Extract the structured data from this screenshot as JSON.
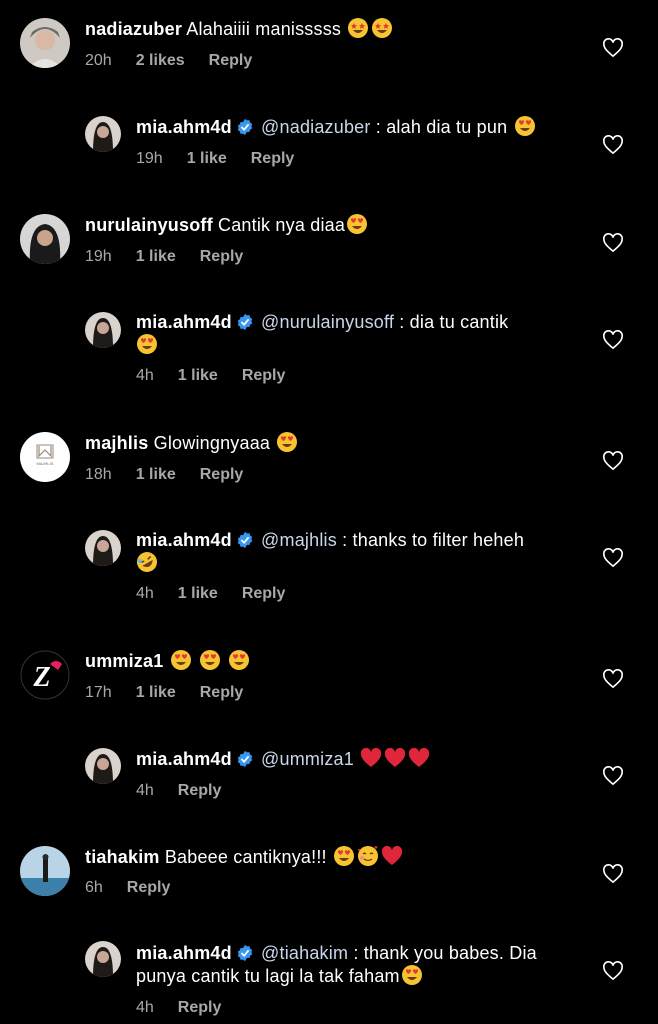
{
  "comments": [
    {
      "user": "nadiazuber",
      "text": "Alahaiiii manisssss",
      "emojis": [
        "star-struck",
        "star-struck"
      ],
      "time": "20h",
      "likes": "2 likes",
      "reply": "Reply"
    },
    {
      "user": "mia.ahm4d",
      "verified": true,
      "mention": "@nadiazuber",
      "text": ": alah dia tu pun",
      "emojis": [
        "heart-eyes"
      ],
      "time": "19h",
      "likes": "1 like",
      "reply": "Reply"
    },
    {
      "user": "nurulainyusoff",
      "text": "Cantik nya diaa",
      "emojis": [
        "heart-eyes"
      ],
      "time": "19h",
      "likes": "1 like",
      "reply": "Reply"
    },
    {
      "user": "mia.ahm4d",
      "verified": true,
      "mention": "@nurulainyusoff",
      "text": ": dia tu cantik",
      "emojis": [
        "heart-eyes"
      ],
      "time": "4h",
      "likes": "1 like",
      "reply": "Reply"
    },
    {
      "user": "majhlis",
      "text": "Glowingnyaaa",
      "emojis": [
        "heart-eyes"
      ],
      "time": "18h",
      "likes": "1 like",
      "reply": "Reply",
      "avatar_text": "MAJHLIS"
    },
    {
      "user": "mia.ahm4d",
      "verified": true,
      "mention": "@majhlis",
      "text": ": thanks to filter heheh",
      "emojis": [
        "rofl"
      ],
      "time": "4h",
      "likes": "1 like",
      "reply": "Reply"
    },
    {
      "user": "ummiza1",
      "text": "",
      "emojis": [
        "heart-eyes",
        "heart-eyes",
        "heart-eyes"
      ],
      "time": "17h",
      "likes": "1 like",
      "reply": "Reply",
      "avatar_text": "Z"
    },
    {
      "user": "mia.ahm4d",
      "verified": true,
      "mention": "@ummiza1",
      "text": "",
      "emojis": [
        "red-heart",
        "red-heart",
        "red-heart"
      ],
      "time": "4h",
      "likes": "",
      "reply": "Reply"
    },
    {
      "user": "tiahakim",
      "text": "Babeee cantiknya!!!",
      "emojis": [
        "heart-eyes",
        "smiling-hearts",
        "red-heart"
      ],
      "time": "6h",
      "likes": "",
      "reply": "Reply"
    },
    {
      "user": "mia.ahm4d",
      "verified": true,
      "mention": "@tiahakim",
      "text": ": thank you babes. Dia",
      "text2": "punya cantik tu lagi la tak faham",
      "emojis": [
        "heart-eyes"
      ],
      "time": "4h",
      "likes": "",
      "reply": "Reply"
    }
  ],
  "icons": {
    "like": "heart-outline-icon",
    "verified": "verified-badge-icon"
  },
  "colors": {
    "background": "#000000",
    "meta": "#a8a8a8",
    "verified": "#3897f0"
  }
}
